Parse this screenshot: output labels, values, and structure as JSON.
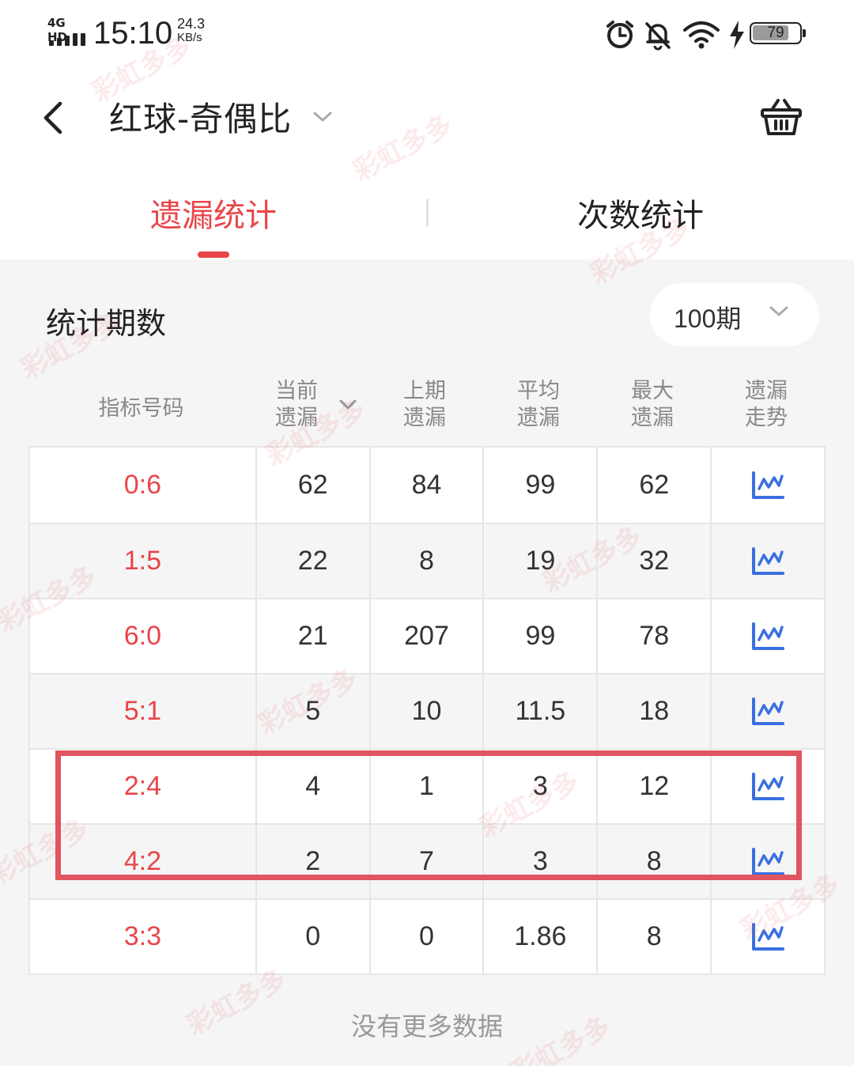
{
  "status_bar": {
    "network_label": "4G HD",
    "time": "15:10",
    "speed_value": "24.3",
    "speed_unit": "KB/s",
    "icons": [
      "alarm-icon",
      "mute-bell-icon",
      "wifi-icon",
      "charging-icon"
    ],
    "battery_level": "79",
    "battery_fraction": 0.79
  },
  "header": {
    "title": "红球-奇偶比",
    "back_icon": "chevron-left-icon",
    "title_dropdown_icon": "chevron-down-icon",
    "basket_icon": "basket-icon"
  },
  "tabs": [
    {
      "label": "遗漏统计",
      "active": true
    },
    {
      "label": "次数统计",
      "active": false
    }
  ],
  "filter": {
    "label": "统计期数",
    "selected_period": "100期"
  },
  "table": {
    "headers": [
      {
        "line1": "指标号码",
        "line2": ""
      },
      {
        "line1": "当前",
        "line2": "遗漏",
        "sortable": true
      },
      {
        "line1": "上期",
        "line2": "遗漏"
      },
      {
        "line1": "平均",
        "line2": "遗漏"
      },
      {
        "line1": "最大",
        "line2": "遗漏"
      },
      {
        "line1": "遗漏",
        "line2": "走势"
      }
    ],
    "rows": [
      {
        "code": "0:6",
        "current": "62",
        "last": "84",
        "avg": "99",
        "max": "62"
      },
      {
        "code": "1:5",
        "current": "22",
        "last": "8",
        "avg": "19",
        "max": "32"
      },
      {
        "code": "6:0",
        "current": "21",
        "last": "207",
        "avg": "99",
        "max": "78"
      },
      {
        "code": "5:1",
        "current": "5",
        "last": "10",
        "avg": "11.5",
        "max": "18"
      },
      {
        "code": "2:4",
        "current": "4",
        "last": "1",
        "avg": "3",
        "max": "12"
      },
      {
        "code": "4:2",
        "current": "2",
        "last": "7",
        "avg": "3",
        "max": "8"
      },
      {
        "code": "3:3",
        "current": "0",
        "last": "0",
        "avg": "1.86",
        "max": "8"
      }
    ],
    "trend_icon": "line-chart-icon"
  },
  "footer_text": "没有更多数据",
  "watermark_text": "彩虹多多",
  "colors": {
    "accent": "#e8464a",
    "trend_blue": "#3a6fe0",
    "highlight": "#e05560"
  }
}
